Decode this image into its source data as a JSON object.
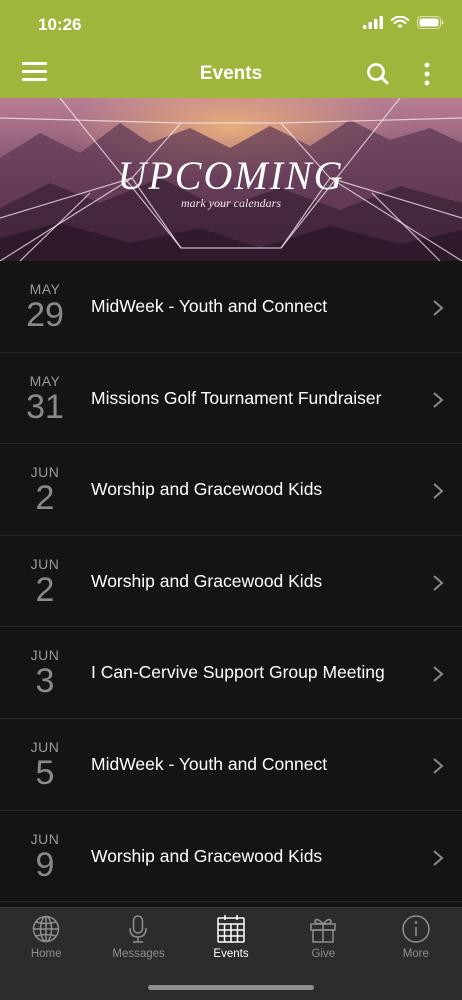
{
  "status": {
    "time": "10:26"
  },
  "app_bar": {
    "title": "Events"
  },
  "banner": {
    "title": "UPCOMING",
    "subtitle": "mark your calendars"
  },
  "events": [
    {
      "month": "MAY",
      "day": "29",
      "title": "MidWeek - Youth and Connect"
    },
    {
      "month": "MAY",
      "day": "31",
      "title": "Missions Golf Tournament Fundraiser"
    },
    {
      "month": "JUN",
      "day": "2",
      "title": "Worship and Gracewood Kids"
    },
    {
      "month": "JUN",
      "day": "2",
      "title": "Worship and Gracewood Kids"
    },
    {
      "month": "JUN",
      "day": "3",
      "title": "I Can-Cervive Support Group Meeting"
    },
    {
      "month": "JUN",
      "day": "5",
      "title": "MidWeek - Youth and Connect"
    },
    {
      "month": "JUN",
      "day": "9",
      "title": "Worship and Gracewood Kids"
    }
  ],
  "tabs": [
    {
      "label": "Home",
      "icon": "globe-icon",
      "active": false
    },
    {
      "label": "Messages",
      "icon": "microphone-icon",
      "active": false
    },
    {
      "label": "Events",
      "icon": "calendar-icon",
      "active": true
    },
    {
      "label": "Give",
      "icon": "gift-icon",
      "active": false
    },
    {
      "label": "More",
      "icon": "info-icon",
      "active": false
    }
  ],
  "colors": {
    "accent": "#9db63b",
    "background": "#141414",
    "tab_bar": "#2c2c2e"
  }
}
